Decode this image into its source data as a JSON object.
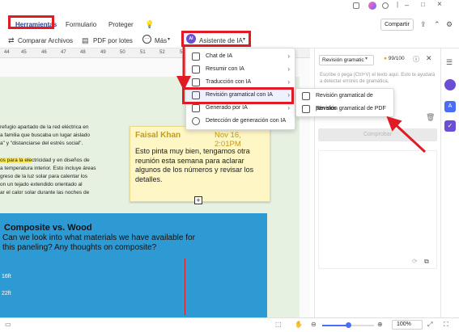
{
  "tabs": [
    "Herramientas",
    "Formulario",
    "Proteger"
  ],
  "header": {
    "share_label": "Compartir"
  },
  "toolbar": {
    "compare_label": "Comparar Archivos",
    "batch_label": "PDF por lotes",
    "more_label": "Más",
    "ai_label": "Asistente de IA",
    "ai_badge": "AI"
  },
  "ruler": [
    "44",
    "45",
    "46",
    "47",
    "48",
    "49",
    "50",
    "51",
    "52",
    "53",
    "54",
    "55",
    "56"
  ],
  "ai_menu": [
    "Chat de IA",
    "Resumir con IA",
    "Traducción con IA",
    "Revisión gramatical con IA",
    "Generado por IA",
    "Detección de generación con IA"
  ],
  "submenu": [
    "Revisión gramatical de párrafos",
    "Revisión gramatical de PDF"
  ],
  "document": {
    "text_lines": [
      "refugio apartado de la red eléctrica en",
      "a familia que buscaba un lugar aislado",
      "a\" y \"distanciarse del estrés social\".",
      "",
      "os para la electricidad y en diseños de",
      "a temperatura interior. Esto incluye áreas",
      "greso de la luz solar para calentar los",
      "on un tejado extendido orientado al",
      "ar el calor solar durante las noches de"
    ],
    "highlight_text": "os para la ele",
    "comment_author": "Faisal Khan",
    "comment_date": "Nov 16, 2:01PM",
    "comment_text": "Esto pinta muy bien, tengamos otra reunión esta semana para aclarar algunos de los números y revisar los detalles.",
    "blue_title": "Composite vs. Wood",
    "blue_text": "Can we look into what materials we have available for this paneling? Any thoughts on composite?",
    "dim1": "16ft",
    "dim2": "22ft"
  },
  "right_panel": {
    "dropdown": "Revisión gramatic",
    "counter": "99/100",
    "placeholder": "Escribe o pega (Ctrl+V) el texto aquí. Esto te ayudará a detectar errores de gramática,",
    "button": "Comprobar"
  },
  "statusbar": {
    "zoom": "100%"
  },
  "colors": {
    "accent_red": "#e01b24",
    "ai_purple": "#6b4dd6",
    "blue_panel": "#2d9ad4"
  }
}
